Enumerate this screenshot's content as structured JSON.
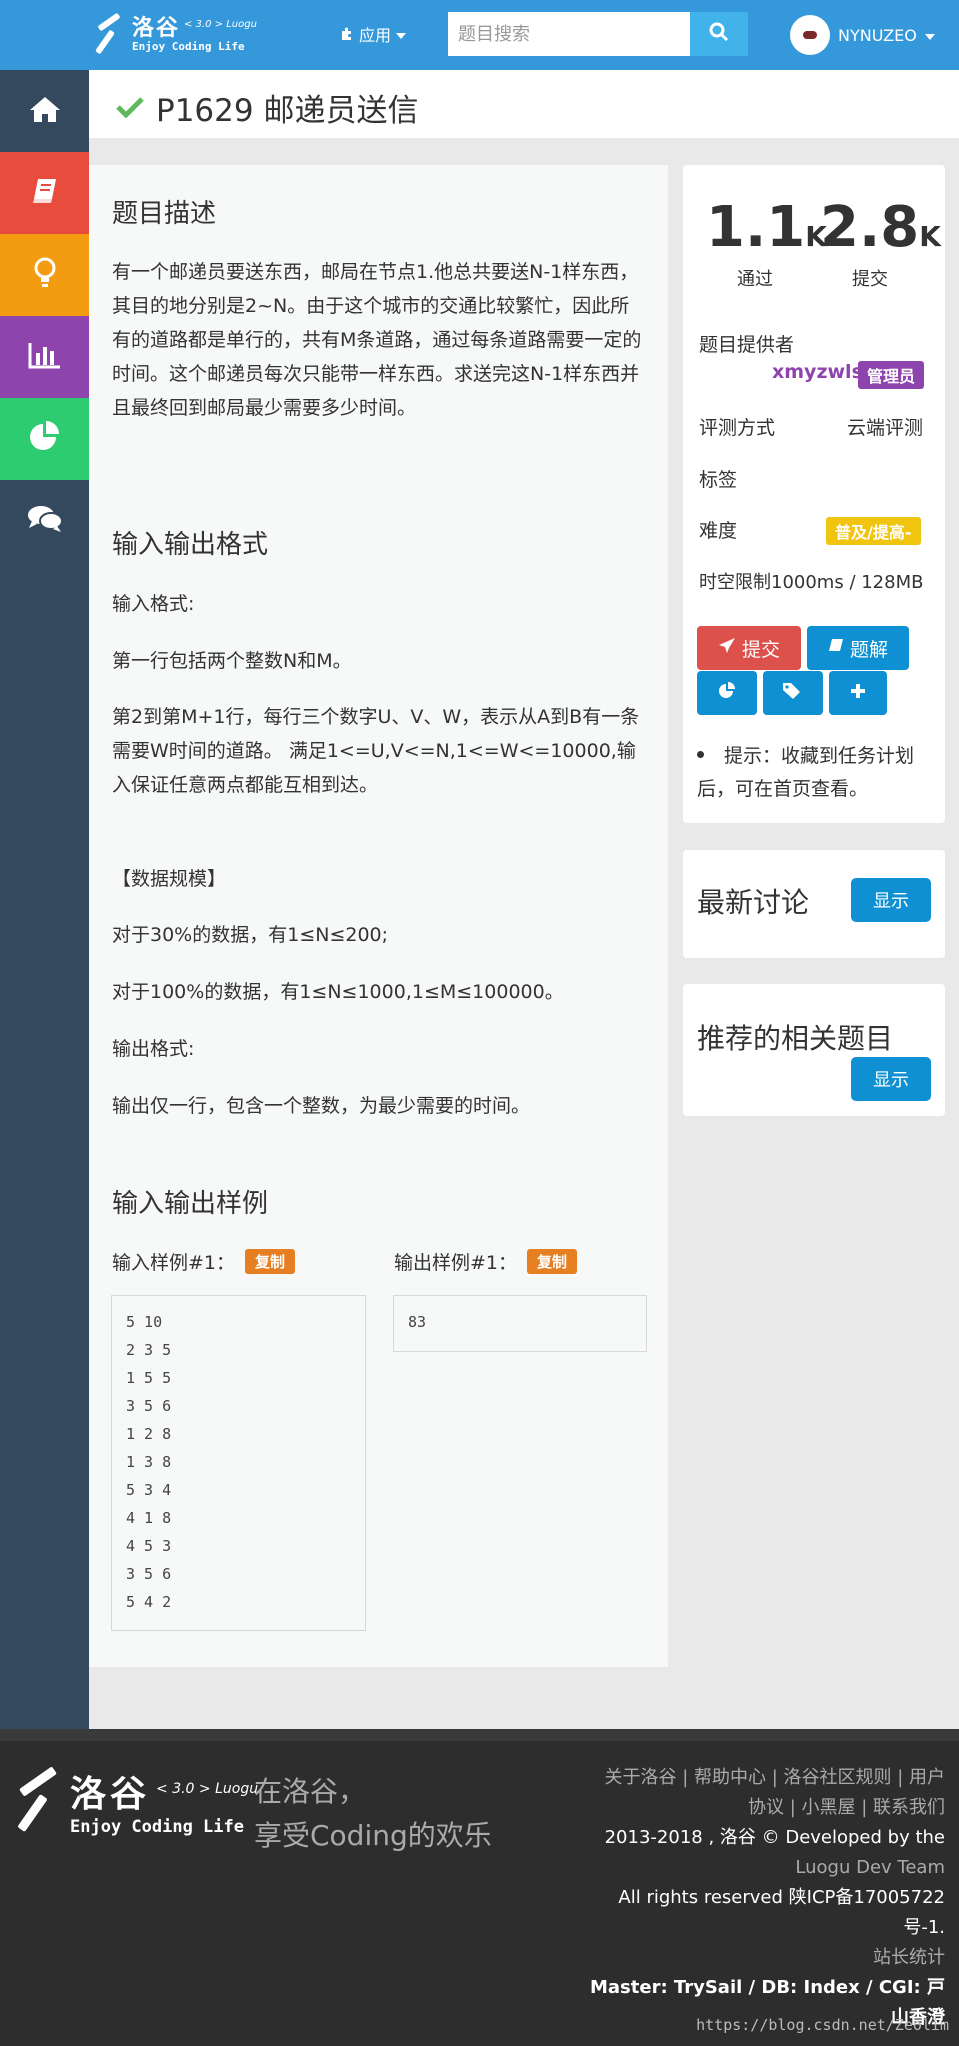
{
  "header": {
    "logo_cn": "洛谷",
    "logo_version": "< 3.0 > Luogu",
    "logo_en": "Enjoy Coding Life",
    "apps_label": "应用",
    "search_placeholder": "题目搜索",
    "username": "NYNUZEO"
  },
  "problem": {
    "title": "P1629 邮递员送信",
    "sections": {
      "description_heading": "题目描述",
      "description": "有一个邮递员要送东西，邮局在节点1.他总共要送N-1样东西，其目的地分别是2~N。由于这个城市的交通比较繁忙，因此所有的道路都是单行的，共有M条道路，通过每条道路需要一定的时间。这个邮递员每次只能带一样东西。求送完这N-1样东西并且最终回到邮局最少需要多少时间。",
      "io_heading": "输入输出格式",
      "input_format_label": "输入格式:",
      "input_line1": "第一行包括两个整数N和M。",
      "input_line2": "第2到第M+1行，每行三个数字U、V、W，表示从A到B有一条需要W时间的道路。 满足1<=U,V<=N,1<=W<=10000,输入保证任意两点都能互相到达。",
      "scale_title": "【数据规模】",
      "scale_30": "对于30%的数据，有1≤N≤200;",
      "scale_100": "对于100%的数据，有1≤N≤1000,1≤M≤100000。",
      "output_format_label": "输出格式:",
      "output_line": "输出仅一行，包含一个整数，为最少需要的时间。",
      "samples_heading": "输入输出样例",
      "input_sample_label": "输入样例#1：",
      "output_sample_label": "输出样例#1：",
      "copy_label": "复制",
      "input_sample": "5 10\n2 3 5\n1 5 5\n3 5 6\n1 2 8\n1 3 8\n5 3 4\n4 1 8\n4 5 3\n3 5 6\n5 4 2",
      "output_sample": "83"
    }
  },
  "stats": {
    "passed_num": "1.1",
    "passed_unit": "K",
    "passed_label": "通过",
    "submit_num": "2.8",
    "submit_unit": "K",
    "submit_label": "提交"
  },
  "info": {
    "provider_label": "题目提供者",
    "provider_name": "xmyzwls",
    "provider_role": "管理员",
    "judge_label": "评测方式",
    "judge_value": "云端评测",
    "tags_label": "标签",
    "difficulty_label": "难度",
    "difficulty_value": "普及/提高-",
    "limits": "时空限制1000ms / 128MB"
  },
  "actions": {
    "submit": "提交",
    "solution": "题解",
    "tip": "提示：收藏到任务计划后，可在首页查看。"
  },
  "discuss": {
    "heading": "最新讨论",
    "show": "显示"
  },
  "related": {
    "heading": "推荐的相关题目",
    "show": "显示"
  },
  "footer": {
    "logo_cn": "洛谷",
    "logo_version": "< 3.0 > Luogu",
    "logo_en": "Enjoy Coding Life",
    "slogan1": "在洛谷，",
    "slogan2": "享受Coding的欢乐",
    "links_line1": "关于洛谷 | 帮助中心 | 洛谷社区规则 | 用户",
    "links_line2": "协议 | 小黑屋 | 联系我们",
    "copyright1": "2013-2018 , 洛谷 © Developed by the",
    "copyright2": "Luogu Dev Team",
    "rights": "All rights reserved 陕ICP备17005722号-1.",
    "stats_link": "站长统计",
    "master": "Master: TrySail / DB: Index / CGI: 戸山香澄",
    "watermark": "https://blog.csdn.net/Zeolim"
  },
  "colors": {
    "header": "#3498db",
    "sidebar": "#34495e",
    "nav_red": "#e74c3c",
    "nav_orange": "#f39c12",
    "nav_purple": "#8e44ad",
    "nav_green": "#2ecc71",
    "submit_btn": "#dd514c",
    "blue_btn": "#0e90d2",
    "admin_badge": "#8e44ad",
    "difficulty_badge": "#f1c40f",
    "copy_badge": "#e67e22",
    "accepted_check": "#5eb95e"
  }
}
